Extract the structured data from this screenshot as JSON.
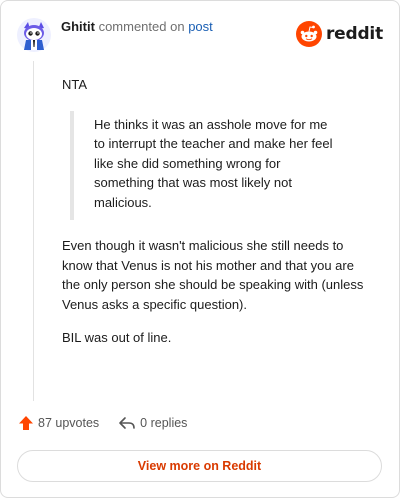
{
  "header": {
    "username": "Ghitit",
    "commented_on_text": "commented on",
    "post_link": "post",
    "brand_name": "reddit",
    "brand_color": "#ff4500"
  },
  "comment": {
    "paragraph1": "NTA",
    "quote": "He thinks it was an asshole move for me to interrupt the teacher and make her feel like she did something wrong for something that was most likely not malicious.",
    "paragraph2": "Even though it wasn't malicious she still needs to know that Venus is not his mother and that you are the only person she should be speaking with (unless Venus asks a specific question).",
    "paragraph3": "BIL was out of line."
  },
  "actions": {
    "upvotes_label": "87 upvotes",
    "replies_label": "0 replies",
    "upvote_icon": "upvote-arrow-icon",
    "reply_icon": "reply-arrow-icon"
  },
  "footer": {
    "view_more_label": "View more on Reddit",
    "accent_color": "#d93a00"
  }
}
